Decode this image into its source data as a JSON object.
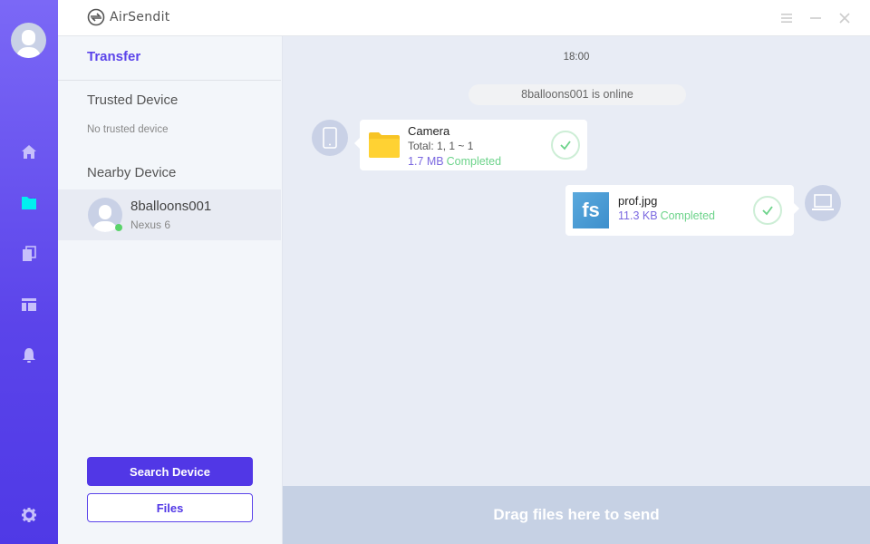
{
  "app": {
    "title": "AirSendit"
  },
  "window_controls": {
    "menu": "menu-icon",
    "minimize": "minimize-icon",
    "close": "close-icon"
  },
  "rail": {
    "items": [
      {
        "name": "home",
        "icon": "home-icon",
        "active": false
      },
      {
        "name": "transfer",
        "icon": "folder-icon",
        "active": true
      },
      {
        "name": "files",
        "icon": "copy-icon",
        "active": false
      },
      {
        "name": "layout",
        "icon": "layout-icon",
        "active": false
      },
      {
        "name": "notifications",
        "icon": "bell-icon",
        "active": false
      }
    ],
    "settings_icon": "gear-icon",
    "colors": {
      "active": "#00f0f0",
      "inactive": "#c7c0fb"
    }
  },
  "sidepanel": {
    "tab": "Transfer",
    "trusted_title": "Trusted Device",
    "trusted_empty": "No trusted device",
    "nearby_title": "Nearby Device",
    "devices": [
      {
        "name": "8balloons001",
        "model": "Nexus 6",
        "online": true
      }
    ],
    "search_button": "Search Device",
    "files_button": "Files"
  },
  "chat": {
    "time": "18:00",
    "online_notice": "8balloons001 is online",
    "messages": [
      {
        "direction": "incoming",
        "type": "folder",
        "name": "Camera",
        "detail": "Total: 1, 1 ~ 1",
        "size": "1.7 MB",
        "status": "Completed"
      },
      {
        "direction": "outgoing",
        "type": "image",
        "thumb_label": "fs",
        "name": "prof.jpg",
        "size": "11.3 KB",
        "status": "Completed"
      }
    ]
  },
  "dropzone": {
    "label": "Drag files here to send"
  },
  "colors": {
    "accent": "#5137e6",
    "completed": "#6cd38a",
    "size": "#7b68e0",
    "online": "#5ad36a"
  }
}
